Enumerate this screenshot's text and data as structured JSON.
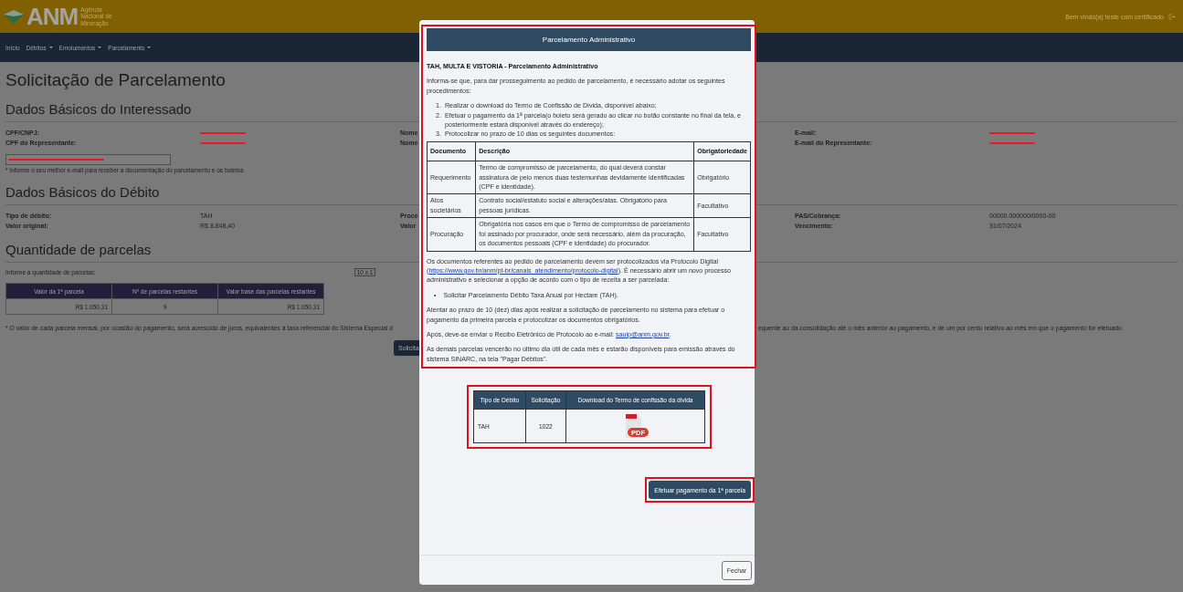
{
  "header": {
    "logo_text": "ANM",
    "logo_subtitle": [
      "Agência",
      "Nacional de",
      "Mineração"
    ],
    "welcome": "Bem vindo(a) teste com certificado"
  },
  "nav": [
    {
      "label": "Início",
      "dropdown": false
    },
    {
      "label": "Débitos",
      "dropdown": true
    },
    {
      "label": "Emolumentos",
      "dropdown": true
    },
    {
      "label": "Parcelamento",
      "dropdown": true
    }
  ],
  "page_title": "Solicitação de Parcelamento",
  "interessado": {
    "title": "Dados Básicos do Interessado",
    "rows": [
      {
        "label": "CPF/CNPJ:",
        "value_redacted": true,
        "label_2": "Nome",
        "label_3": "E-mail:",
        "value_3_redacted": true
      },
      {
        "label": "CPF do Representante:",
        "value_redacted": true,
        "label_2": "Nome",
        "label_3": "E-mail do Representante:",
        "value_3_redacted": true
      }
    ],
    "email_field": {
      "redacted": true
    },
    "email_note": "* Informe o seu melhor e-mail para receber a documentação do parcelamento e os boletos"
  },
  "debito": {
    "title": "Dados Básicos do Débito",
    "rows": [
      {
        "label": "Tipo de débito:",
        "value": "TAH",
        "label_2": "Proce",
        "label_3": "PAS/Cobrança:",
        "value_3": "00000.000000/0000-00"
      },
      {
        "label": "Valor original:",
        "value": "R$ 8.848,40",
        "label_2": "Valor",
        "label_3": "Vencimento:",
        "value_3": "31/07/2024"
      }
    ]
  },
  "parcelas": {
    "title": "Quantidade de parcelas",
    "prompt": "Informe a quantidade de parcelas:",
    "select_value": "10 x 1",
    "columns": [
      "Valor da 1ª parcela",
      "Nº de parcelas restantes",
      "Valor base das parcelas restantes"
    ],
    "row": [
      "R$ 1.050,31",
      "9",
      "R$ 1.050,31"
    ],
    "footnote_left": "* O valor de cada parcela mensal, por ocasião do pagamento, será acrescido de juros, equivalentes à taxa referencial do Sistema Especial d",
    "footnote_right": "equente ao da consolidação até o mês anterior ao pagamento, e de um por cento relativo ao mês em que o pagamento for efetuado.",
    "submit": "Solicita"
  },
  "modal": {
    "title": "Parcelamento Administrativo",
    "heading": "TAH, MULTA E VISTORIA - Parcelamento Administrativo",
    "intro": "Informa-se que, para dar prosseguimento ao pedido de parcelamento, é necessário adotar os seguintes procedimentos:",
    "steps": [
      {
        "number": "1.",
        "text": "Realizar o download do Termo de Confissão de Dívida, disponível abaixo;"
      },
      {
        "number": "2.",
        "text": "Efetuar o pagamento da 1ª parcela(o boleto será gerado ao clicar no botão constante no final da tela, e posteriormente estará disponível através do endereço);"
      },
      {
        "number": "3.",
        "text": "Protocolizar no prazo de 10 dias os seguintes documentos:"
      }
    ],
    "doc_columns": [
      "Documento",
      "Descrição",
      "Obrigatoriedade"
    ],
    "doc_rows": [
      [
        "Requerimento",
        "Termo de compromisso de parcelamento, do qual deverá constar assinatura de pelo menos duas testemunhas devidamente identificadas (CPF e identidade).",
        "Obrigatório"
      ],
      [
        "Atos societários",
        "Contrato social/estatuto social e alterações/atas. Obrigatório para pessoas jurídicas.",
        "Facultativo"
      ],
      [
        "Procuração",
        "Obrigatória nos casos em que o Termo de compromisso de parcelamento foi assinado por procurador, onde será necessário, além da procuração, os documentos pessoais (CPF e identidade) do procurador.",
        "Facultativo"
      ]
    ],
    "paragraphs": [
      [
        {
          "kind": "text",
          "text": "Os documentos referentes ao pedido de parcelamento devem ser protocolizados via Protocolo Digital ("
        },
        {
          "kind": "link",
          "text": "https://www.gov.br/anm/pt-br/canais_atendimento/protocolo-digital"
        },
        {
          "kind": "text",
          "text": "). É necessário abrir um novo processo administrativo e selecionar a opção de acordo com o tipo de receita a ser parcelada:"
        }
      ],
      [
        {
          "kind": "bullet",
          "text": "•"
        },
        {
          "kind": "text",
          "text": "Solicitar Parcelamento Débito Taxa Anual por Hectare (TAH)."
        }
      ],
      [
        {
          "kind": "text",
          "text": "Atentar ao prazo de 10 (dez) dias após realizar a solicitação de parcelamento no sistema para efetuar o pagamento da primeira parcela e protocolizar os documentos obrigatórios."
        }
      ],
      [
        {
          "kind": "text",
          "text": "Após, deve-se enviar o Recibo Eletrônico de Protocolo ao e-mail: "
        },
        {
          "kind": "link",
          "text": "sauip@anm.gov.br"
        },
        {
          "kind": "text",
          "text": "."
        }
      ],
      [
        {
          "kind": "text",
          "text": "As demais parcelas vencerão no último dia útil de cada mês e estarão disponíveis para emissão através do sistema SINARC, na tela \"Pagar Débitos\"."
        }
      ]
    ],
    "download_columns": [
      "Tipo de Débito",
      "Solicitação",
      "Download do Termo de confissão da dívida"
    ],
    "download_row": {
      "tipo": "TAH",
      "solicitacao": "1022",
      "file_label": "PDF"
    },
    "pay_button": "Efetuar pagamento da 1ª parcela",
    "close_button": "Fechar"
  }
}
